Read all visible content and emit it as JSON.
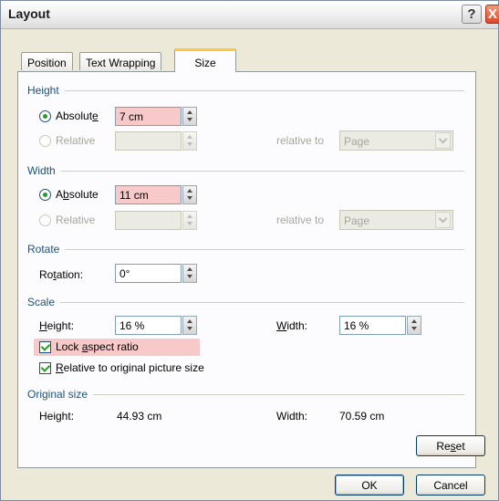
{
  "window": {
    "title": "Layout"
  },
  "titlebar": {
    "help_label": "?",
    "close_label": "X"
  },
  "tabs": [
    {
      "label": "Position"
    },
    {
      "label": "Text Wrapping"
    },
    {
      "label": "Size"
    }
  ],
  "height_section": {
    "title": "Height",
    "absolute_label_pre": "Absolut",
    "absolute_label_key": "e",
    "absolute_value": "7 cm",
    "relative_label": "Relative",
    "relative_to_label": "relative to",
    "relative_to_value": "Page"
  },
  "width_section": {
    "title": "Width",
    "absolute_label_pre": "A",
    "absolute_label_key": "b",
    "absolute_label_post": "solute",
    "absolute_value": "11 cm",
    "relative_label": "Relative",
    "relative_to_label": "relative to",
    "relative_to_value": "Page"
  },
  "rotate_section": {
    "title": "Rotate",
    "rotation_label_pre": "Ro",
    "rotation_label_key": "t",
    "rotation_label_post": "ation:",
    "rotation_value": "0°"
  },
  "scale_section": {
    "title": "Scale",
    "height_label_key": "H",
    "height_label_post": "eight:",
    "height_value": "16 %",
    "width_label_key": "W",
    "width_label_post": "idth:",
    "width_value": "16 %",
    "lock_pre": "Lock ",
    "lock_key": "a",
    "lock_post": "spect ratio",
    "lock_checked": true,
    "relative_key": "R",
    "relative_post": "elative to original picture size",
    "relative_checked": true
  },
  "original_size": {
    "title": "Original size",
    "height_label": "Height:",
    "height_value": "44.93 cm",
    "width_label": "Width:",
    "width_value": "70.59 cm"
  },
  "buttons": {
    "reset_pre": "Re",
    "reset_key": "s",
    "reset_post": "et",
    "ok": "OK",
    "cancel": "Cancel"
  },
  "colors": {
    "section_title": "#1c5180",
    "highlight": "#f8c9c9",
    "tab_accent": "#ffc83c"
  }
}
